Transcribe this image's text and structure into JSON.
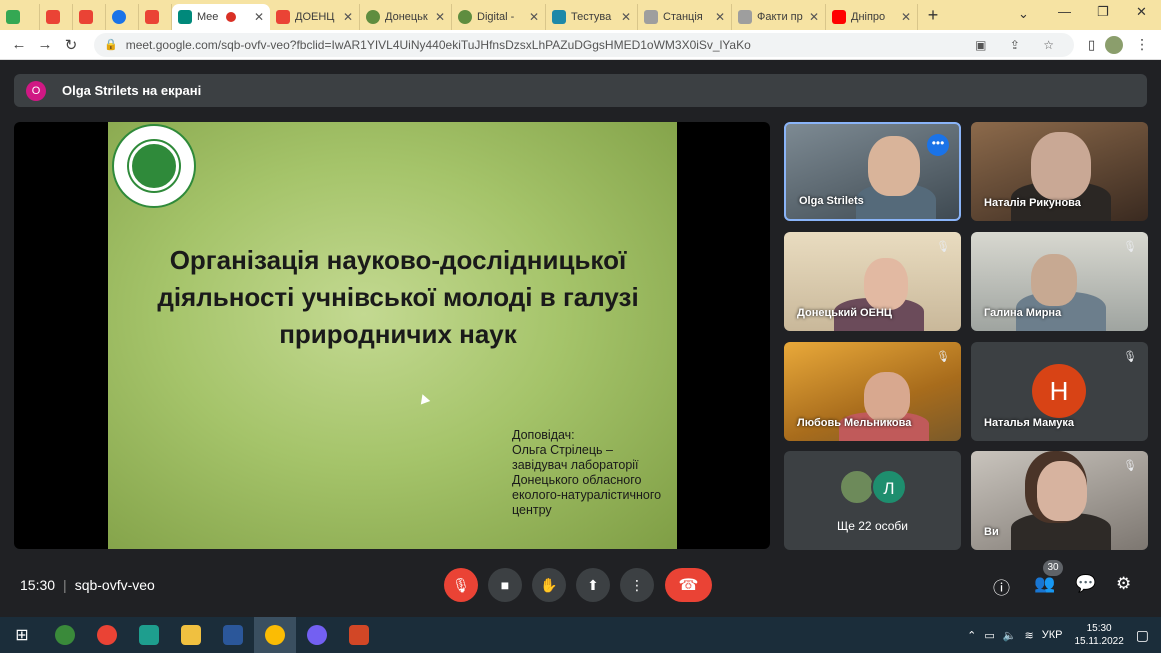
{
  "browser": {
    "tabs": [
      {
        "title": "",
        "color": "#34a853"
      },
      {
        "title": "",
        "color": "#ea4335"
      },
      {
        "title": "",
        "color": "#ea4335"
      },
      {
        "title": "",
        "color": "#1a73e8"
      },
      {
        "title": "",
        "color": "#ea4335"
      },
      {
        "title": "Mee",
        "color": "#00897b",
        "active": true
      },
      {
        "title": "ДОЕНЦ",
        "color": "#ea4335"
      },
      {
        "title": "Донецьк",
        "color": "#5f8d3f"
      },
      {
        "title": "Digital -",
        "color": "#5f8d3f"
      },
      {
        "title": "Тестува",
        "color": "#1e88a8"
      },
      {
        "title": "Станція",
        "color": "#9e9e9e"
      },
      {
        "title": "Факти пр",
        "color": "#9e9e9e"
      },
      {
        "title": "Дніпро",
        "color": "#ff0000"
      }
    ],
    "url": "meet.google.com/sqb-ovfv-veo?fbclid=IwAR1YIVL4UiNy440ekiTuJHfnsDzsxLhPAZuDGgsHMED1oWM3X0iSv_lYaKo"
  },
  "banner": {
    "avatar_letter": "O",
    "text": "Olga Strilets на екрані"
  },
  "slide": {
    "title": "Організація науково-дослідницької діяльності учнівської молоді в галузі природничих наук",
    "speaker": "Доповідач:\nОльга Стрілець –\nзавідувач лабораторії\nДонецького обласного\nеколого-натуралістичного\nцентру"
  },
  "participants": [
    {
      "name": "Olga Strilets"
    },
    {
      "name": "Наталія Рикунова"
    },
    {
      "name": "Донецький ОЕНЦ"
    },
    {
      "name": "Галина Мирна"
    },
    {
      "name": "Любовь Мельникова"
    },
    {
      "name": "Наталья Мамука",
      "letter": "Н"
    },
    {
      "name": "Ще 22 особи",
      "letter": "Л"
    },
    {
      "name": "Ви"
    }
  ],
  "controls": {
    "time": "15:30",
    "meeting_code": "sqb-ovfv-veo",
    "people_count": "30"
  },
  "taskbar": {
    "lang": "УКР",
    "time": "15:30",
    "date": "15.11.2022"
  }
}
